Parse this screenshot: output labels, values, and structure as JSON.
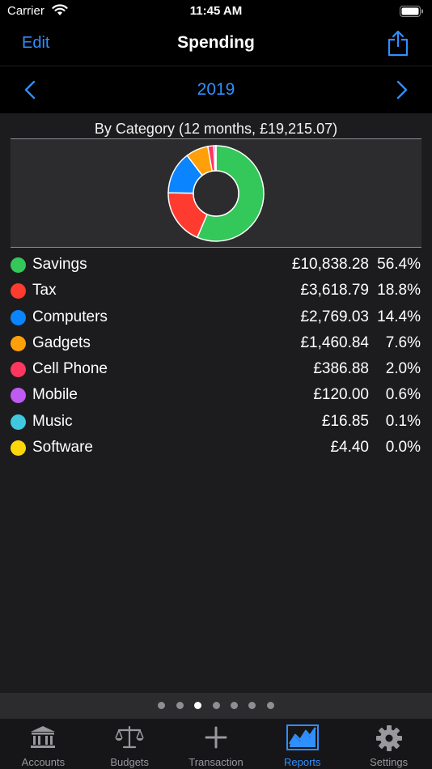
{
  "status": {
    "carrier": "Carrier",
    "time": "11:45 AM"
  },
  "nav": {
    "edit_label": "Edit",
    "title": "Spending"
  },
  "year": {
    "label": "2019"
  },
  "report": {
    "title": "By Category (12 months, £19,215.07)"
  },
  "categories": [
    {
      "name": "Savings",
      "amount": "£10,838.28",
      "percent": "56.4%",
      "value": 10838.28,
      "color": "#34c759"
    },
    {
      "name": "Tax",
      "amount": "£3,618.79",
      "percent": "18.8%",
      "value": 3618.79,
      "color": "#ff3b30"
    },
    {
      "name": "Computers",
      "amount": "£2,769.03",
      "percent": "14.4%",
      "value": 2769.03,
      "color": "#0a84ff"
    },
    {
      "name": "Gadgets",
      "amount": "£1,460.84",
      "percent": "7.6%",
      "value": 1460.84,
      "color": "#ff9f0a"
    },
    {
      "name": "Cell Phone",
      "amount": "£386.88",
      "percent": "2.0%",
      "value": 386.88,
      "color": "#ff375f"
    },
    {
      "name": "Mobile",
      "amount": "£120.00",
      "percent": "0.6%",
      "value": 120.0,
      "color": "#bf5af2"
    },
    {
      "name": "Music",
      "amount": "£16.85",
      "percent": "0.1%",
      "value": 16.85,
      "color": "#40c8e0"
    },
    {
      "name": "Software",
      "amount": "£4.40",
      "percent": "0.0%",
      "value": 4.4,
      "color": "#ffd60a"
    }
  ],
  "chart_data": {
    "type": "pie",
    "categories": [
      "Savings",
      "Tax",
      "Computers",
      "Gadgets",
      "Cell Phone",
      "Mobile",
      "Music",
      "Software"
    ],
    "values": [
      10838.28,
      3618.79,
      2769.03,
      1460.84,
      386.88,
      120.0,
      16.85,
      4.4
    ],
    "title": "By Category (12 months, £19,215.07)"
  },
  "pages": {
    "count": 7,
    "active": 2
  },
  "tabs": [
    {
      "label": "Accounts",
      "icon": "bank-icon"
    },
    {
      "label": "Budgets",
      "icon": "scales-icon"
    },
    {
      "label": "Transaction",
      "icon": "plus-icon"
    },
    {
      "label": "Reports",
      "icon": "chart-icon"
    },
    {
      "label": "Settings",
      "icon": "gear-icon"
    }
  ],
  "colors": {
    "accent": "#2f8fff",
    "background": "#000000",
    "panel": "#1c1c1e"
  }
}
